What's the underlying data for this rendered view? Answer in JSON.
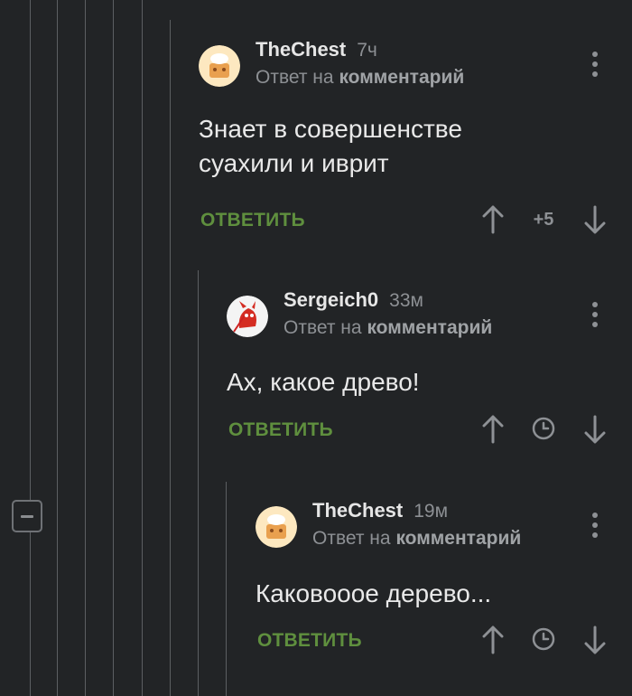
{
  "comments": [
    {
      "author": "TheChest",
      "time": "7ч",
      "reply_prefix": "Ответ на",
      "reply_target": "комментарий",
      "text_lines": [
        "Знает в совершенстве",
        "суахили и иврит"
      ],
      "reply_label": "ОТВЕТИТЬ",
      "rating": "+5"
    },
    {
      "author": "Sergeich0",
      "time": "33м",
      "reply_prefix": "Ответ на",
      "reply_target": "комментарий",
      "text_lines": [
        "Ах, какое древо!"
      ],
      "reply_label": "ОТВЕТИТЬ"
    },
    {
      "author": "TheChest",
      "time": "19м",
      "reply_prefix": "Ответ на",
      "reply_target": "комментарий",
      "text_lines": [
        "Каковооое дерево..."
      ],
      "reply_label": "ОТВЕТИТЬ"
    }
  ],
  "icons": {
    "upvote": "arrow-up-icon",
    "downvote": "arrow-down-icon",
    "pending_rating": "clock-icon",
    "menu": "more-vertical-icon",
    "collapse": "minus-box-icon"
  },
  "colors": {
    "background": "#222426",
    "accent": "#5f8f3e",
    "muted": "#8d9094"
  }
}
